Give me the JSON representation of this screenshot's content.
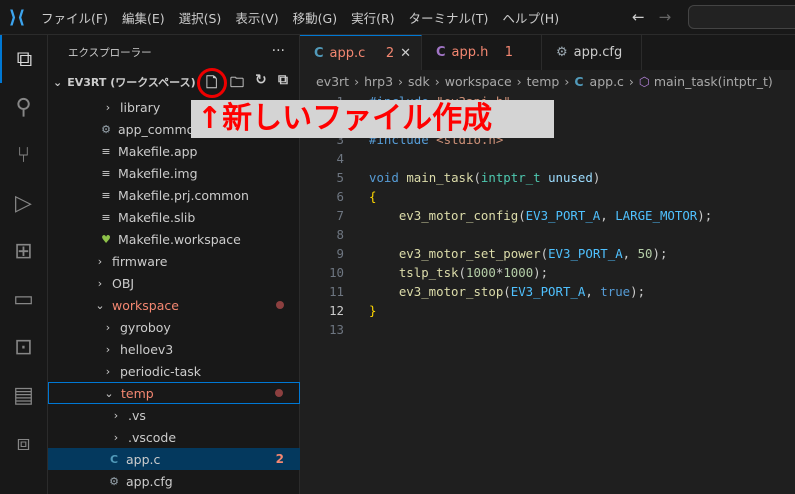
{
  "menu": [
    "ファイル(F)",
    "編集(E)",
    "選択(S)",
    "表示(V)",
    "移動(G)",
    "実行(R)",
    "ターミナル(T)",
    "ヘルプ(H)"
  ],
  "sidebar": {
    "title": "エクスプローラー",
    "more": "···",
    "workspace": "EV3RT (ワークスペース)",
    "items": [
      {
        "label": "library",
        "type": "folder",
        "indent": 1
      },
      {
        "label": "app_common.cfg",
        "type": "gear",
        "indent": 1
      },
      {
        "label": "Makefile.app",
        "type": "file",
        "indent": 1
      },
      {
        "label": "Makefile.img",
        "type": "file",
        "indent": 1
      },
      {
        "label": "Makefile.prj.common",
        "type": "file",
        "indent": 1
      },
      {
        "label": "Makefile.slib",
        "type": "file",
        "indent": 1
      },
      {
        "label": "Makefile.workspace",
        "type": "heart",
        "indent": 1
      },
      {
        "label": "firmware",
        "type": "folder",
        "indent": 0
      },
      {
        "label": "OBJ",
        "type": "folder",
        "indent": 0
      },
      {
        "label": "workspace",
        "type": "folder-open",
        "indent": 0,
        "modified": true
      },
      {
        "label": "gyroboy",
        "type": "folder",
        "indent": 1
      },
      {
        "label": "helloev3",
        "type": "folder",
        "indent": 1
      },
      {
        "label": "periodic-task",
        "type": "folder",
        "indent": 1
      },
      {
        "label": "temp",
        "type": "folder-open",
        "indent": 1,
        "modified": true
      },
      {
        "label": ".vs",
        "type": "folder",
        "indent": 2
      },
      {
        "label": ".vscode",
        "type": "folder",
        "indent": 2
      },
      {
        "label": "app.c",
        "type": "c",
        "indent": 2,
        "badge": "2"
      },
      {
        "label": "app.cfg",
        "type": "gear",
        "indent": 2
      }
    ]
  },
  "tabs": [
    {
      "label": "app.c",
      "badge": "2",
      "active": true
    },
    {
      "label": "app.h",
      "badge": "1"
    },
    {
      "label": "app.cfg"
    }
  ],
  "breadcrumb": [
    "ev3rt",
    "hrp3",
    "sdk",
    "workspace",
    "temp",
    "app.c",
    "main_task(intptr_t)"
  ],
  "annotation": "↑新しいファイル作成",
  "code": {
    "current_line": 12,
    "lines": [
      "#include \"ev3api.h\"",
      "#include \"app.h\"",
      "#include <stdio.h>",
      "",
      "void main_task(intptr_t unused)",
      "{",
      "    ev3_motor_config(EV3_PORT_A, LARGE_MOTOR);",
      "",
      "    ev3_motor_set_power(EV3_PORT_A, 50);",
      "    tslp_tsk(1000*1000);",
      "    ev3_motor_stop(EV3_PORT_A, true);",
      "}",
      ""
    ]
  }
}
